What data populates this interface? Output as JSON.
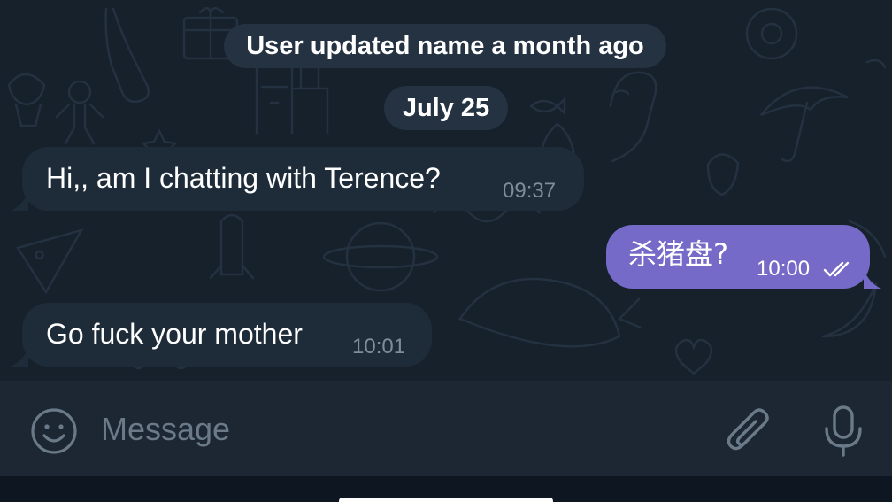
{
  "chat": {
    "service_message": "User updated name a month ago",
    "date_separator": "July 25",
    "messages": [
      {
        "direction": "incoming",
        "text": "Hi,, am I chatting with Terence?",
        "time": "09:37"
      },
      {
        "direction": "outgoing",
        "text": "杀猪盘?",
        "time": "10:00",
        "status": "read"
      },
      {
        "direction": "incoming",
        "text": "Go fuck your mother",
        "time": "10:01"
      }
    ]
  },
  "composer": {
    "placeholder": "Message",
    "icons": {
      "emoji": "emoji-icon",
      "attach": "paperclip-icon",
      "mic": "microphone-icon"
    }
  },
  "colors": {
    "chat_background": "#17212b",
    "incoming_bubble": "#1e2c3a",
    "outgoing_bubble": "#766ac8",
    "service_pill": "#243242",
    "composer_background": "#1c2733",
    "secondary_text": "#7f8c99"
  }
}
